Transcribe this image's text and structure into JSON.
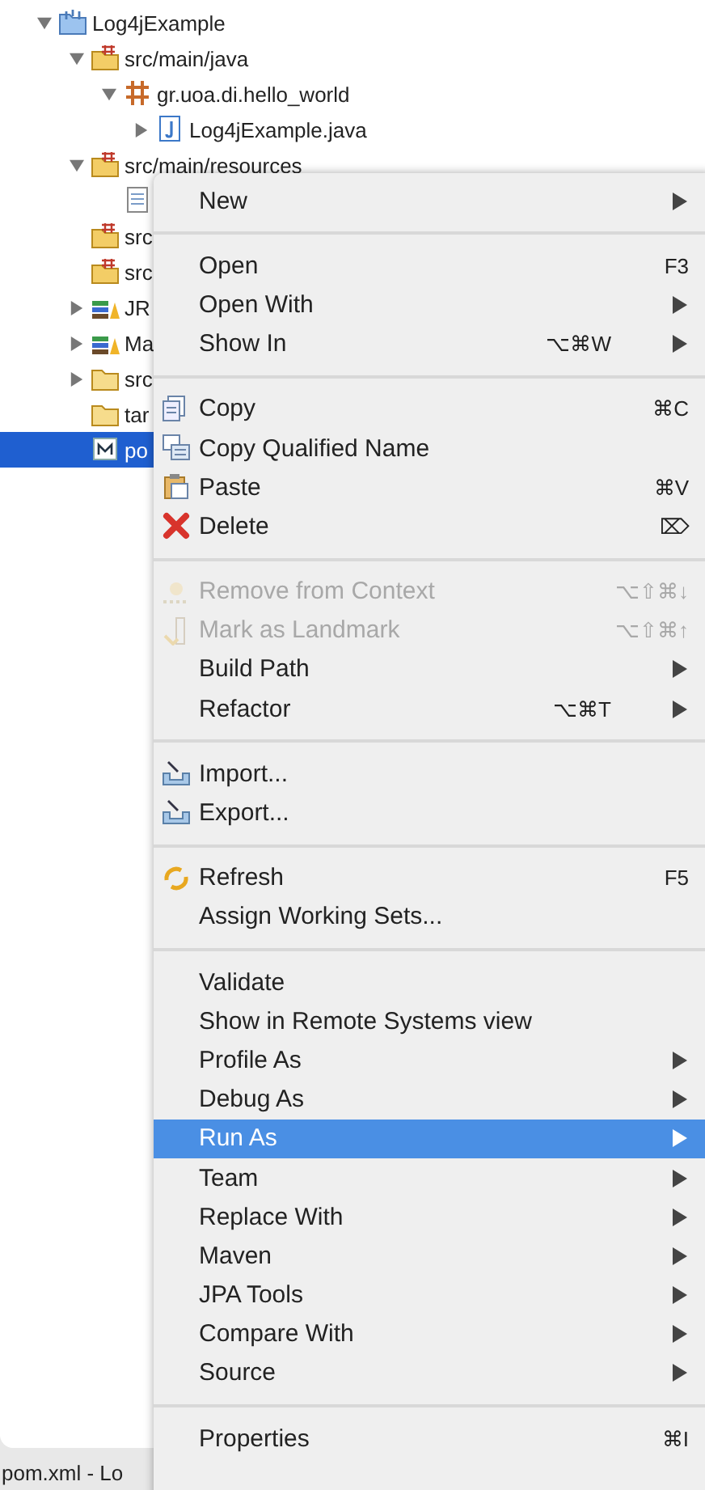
{
  "tree": [
    {
      "label": "Log4jExample",
      "kind": "project",
      "expanded": true,
      "selected": false,
      "children": [
        {
          "label": "src/main/java",
          "kind": "source-folder",
          "expanded": true,
          "selected": false,
          "children": [
            {
              "label": "gr.uoa.di.hello_world",
              "kind": "package",
              "expanded": true,
              "selected": false,
              "children": [
                {
                  "label": "Log4jExample.java",
                  "kind": "java-file",
                  "expanded": false,
                  "selected": false
                }
              ]
            }
          ]
        },
        {
          "label": "src/main/resources",
          "kind": "source-folder",
          "expanded": true,
          "selected": false,
          "children": [
            {
              "kind": "text-file",
              "selected": false
            }
          ]
        },
        {
          "label": "src",
          "kind": "source-folder",
          "selected": false
        },
        {
          "label": "src",
          "kind": "source-folder",
          "selected": false
        },
        {
          "label": "JR",
          "kind": "library",
          "expanded": false,
          "selected": false
        },
        {
          "label": "Ma",
          "kind": "library",
          "expanded": false,
          "selected": false
        },
        {
          "label": "src",
          "kind": "folder",
          "expanded": false,
          "selected": false
        },
        {
          "label": "tar",
          "kind": "folder",
          "selected": false
        },
        {
          "label": "po",
          "kind": "maven-file",
          "selected": true
        }
      ]
    }
  ],
  "status_bar": {
    "text": "pom.xml - Lo"
  },
  "context_menu": {
    "groups": [
      [
        {
          "label": "New",
          "submenu": true,
          "disabled": false,
          "selected": false
        }
      ],
      [
        {
          "label": "Open",
          "shortcut": "F3",
          "submenu": false,
          "disabled": false,
          "selected": false
        },
        {
          "label": "Open With",
          "submenu": true,
          "disabled": false,
          "selected": false
        },
        {
          "label": "Show In",
          "shortcut": "⌥⌘W",
          "submenu": true,
          "disabled": false,
          "selected": false
        }
      ],
      [
        {
          "label": "Copy",
          "kind": "copy",
          "shortcut": "⌘C",
          "submenu": false,
          "disabled": false,
          "selected": false
        },
        {
          "label": "Copy Qualified Name",
          "kind": "copy-name",
          "submenu": false,
          "disabled": false,
          "selected": false
        },
        {
          "label": "Paste",
          "kind": "paste",
          "shortcut": "⌘V",
          "submenu": false,
          "disabled": false,
          "selected": false
        },
        {
          "label": "Delete",
          "kind": "delete",
          "shortcut": "⌦",
          "submenu": false,
          "disabled": false,
          "selected": false
        }
      ],
      [
        {
          "label": "Remove from Context",
          "kind": "context",
          "shortcut": "⌥⇧⌘↓",
          "submenu": false,
          "disabled": true,
          "selected": false
        },
        {
          "label": "Mark as Landmark",
          "kind": "landmark",
          "shortcut": "⌥⇧⌘↑",
          "submenu": false,
          "disabled": true,
          "selected": false
        },
        {
          "label": "Build Path",
          "submenu": true,
          "disabled": false,
          "selected": false
        },
        {
          "label": "Refactor",
          "shortcut": "⌥⌘T",
          "submenu": true,
          "disabled": false,
          "selected": false
        }
      ],
      [
        {
          "label": "Import...",
          "kind": "import",
          "submenu": false,
          "disabled": false,
          "selected": false
        },
        {
          "label": "Export...",
          "kind": "export",
          "submenu": false,
          "disabled": false,
          "selected": false
        }
      ],
      [
        {
          "label": "Refresh",
          "kind": "refresh",
          "shortcut": "F5",
          "submenu": false,
          "disabled": false,
          "selected": false
        },
        {
          "label": "Assign Working Sets...",
          "submenu": false,
          "disabled": false,
          "selected": false
        }
      ],
      [
        {
          "label": "Validate",
          "submenu": false,
          "disabled": false,
          "selected": false
        },
        {
          "label": "Show in Remote Systems view",
          "submenu": false,
          "disabled": false,
          "selected": false
        },
        {
          "label": "Profile As",
          "submenu": true,
          "disabled": false,
          "selected": false
        },
        {
          "label": "Debug As",
          "submenu": true,
          "disabled": false,
          "selected": false
        },
        {
          "label": "Run As",
          "submenu": true,
          "disabled": false,
          "selected": true
        },
        {
          "label": "Team",
          "submenu": true,
          "disabled": false,
          "selected": false
        },
        {
          "label": "Replace With",
          "submenu": true,
          "disabled": false,
          "selected": false
        },
        {
          "label": "Maven",
          "submenu": true,
          "disabled": false,
          "selected": false
        },
        {
          "label": "JPA Tools",
          "submenu": true,
          "disabled": false,
          "selected": false
        },
        {
          "label": "Compare With",
          "submenu": true,
          "disabled": false,
          "selected": false
        },
        {
          "label": "Source",
          "submenu": true,
          "disabled": false,
          "selected": false
        }
      ],
      [
        {
          "label": "Properties",
          "shortcut": "⌘I",
          "submenu": false,
          "disabled": false,
          "selected": false
        }
      ]
    ]
  }
}
